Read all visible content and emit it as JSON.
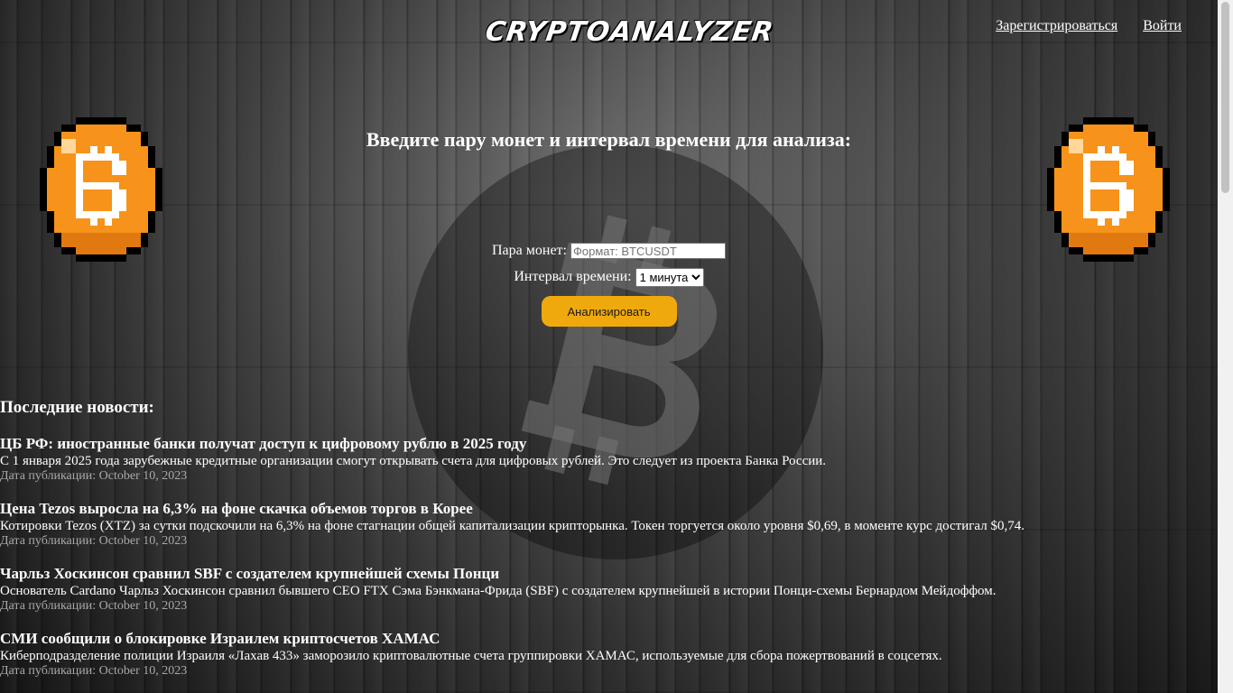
{
  "header": {
    "logo": "CRYPTOANALYZER",
    "register_link": "Зарегистрироваться",
    "login_link": "Войти"
  },
  "form": {
    "heading": "Введите пару монет и интервал времени для анализа:",
    "pair_label": "Пара монет:",
    "pair_placeholder": "Формат: BTCUSDT",
    "interval_label": "Интервал времени:",
    "interval_selected": "1 минута",
    "submit_label": "Анализировать"
  },
  "news": {
    "title": "Последние новости:",
    "date_prefix": "Дата публикации:",
    "items": [
      {
        "title": "ЦБ РФ: иностранные банки получат доступ к цифровому рублю в 2025 году",
        "text": "С 1 января 2025 года зарубежные кредитные организации смогут открывать счета для цифровых рублей. Это следует из проекта Банка России.",
        "date": "Дата публикации: October 10, 2023"
      },
      {
        "title": "Цена Tezos выросла на 6,3% на фоне скачка объемов торгов в Корее",
        "text": "Котировки Tezos (XTZ) за сутки подскочили на 6,3% на фоне стагнации общей капитализации крипторынка. Токен торгуется около уровня $0,69, в моменте курс достигал $0,74.",
        "date": "Дата публикации: October 10, 2023"
      },
      {
        "title": "Чарльз Хоскинсон сравнил SBF с создателем крупнейшей схемы Понци",
        "text": "Основатель Cardano Чарльз Хоскинсон сравнил бывшего CEO FTX Сэма Бэнкмана-Фрида (SBF) с создателем крупнейшей в истории Понци-схемы Бернардом Мейдоффом.",
        "date": "Дата публикации: October 10, 2023"
      },
      {
        "title": "СМИ сообщили о блокировке Израилем криптосчетов ХАМАС",
        "text": "Киберподразделение полиции Израиля «Лахав 433» заморозило криптовалютные счета группировки ХАМАС, используемые для сбора пожертвований в соцсетях.",
        "date": "Дата публикации: October 10, 2023"
      }
    ]
  },
  "colors": {
    "accent": "#f0a90d",
    "coin_orange": "#f7931a",
    "date_gray": "#a9a9a9"
  },
  "icons": {
    "big_background": "bitcoin-logo-icon",
    "left_decoration": "pixel-bitcoin-icon",
    "right_decoration": "pixel-bitcoin-icon"
  }
}
